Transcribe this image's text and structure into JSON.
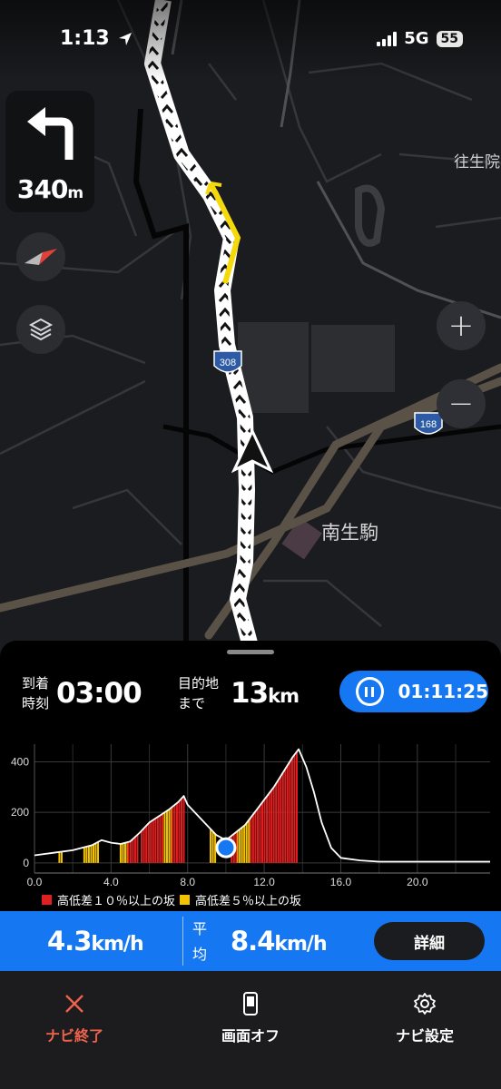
{
  "status_bar": {
    "time": "1:13",
    "network": "5G",
    "battery": "55"
  },
  "turn": {
    "distance": "340",
    "unit": "m"
  },
  "map": {
    "places": [
      {
        "id": "ojoin",
        "label": "往生院"
      },
      {
        "id": "minami",
        "label": "南生駒"
      }
    ],
    "route_shields": [
      {
        "id": "r308",
        "label": "308"
      },
      {
        "id": "r168",
        "label": "168"
      }
    ]
  },
  "controls": {
    "zoom_in": "+",
    "zoom_out": "−"
  },
  "trip": {
    "arrival_label_1": "到着",
    "arrival_label_2": "時刻",
    "arrival_time": "03:00",
    "dest_label_1": "目的地",
    "dest_label_2": "まで",
    "dest_distance": "13",
    "dest_unit": "km",
    "elapsed": "01:11:25"
  },
  "chart_data": {
    "type": "area",
    "title": "",
    "xlabel": "",
    "ylabel": "",
    "x_ticks": [
      "0.0",
      "4.0",
      "8.0",
      "12.0",
      "16.0",
      "20.0"
    ],
    "y_ticks": [
      "0",
      "200",
      "400"
    ],
    "xlim": [
      0,
      23.8
    ],
    "ylim": [
      -40,
      470
    ],
    "x": [
      0,
      1,
      2,
      3,
      3.5,
      4,
      4.5,
      5,
      5.5,
      6,
      6.5,
      7,
      7.5,
      7.8,
      8,
      8.5,
      9,
      9.5,
      10,
      10.5,
      11,
      11.5,
      12,
      12.5,
      13,
      13.5,
      13.8,
      14.2,
      14.6,
      15,
      15.5,
      16,
      17,
      18,
      19,
      20,
      21,
      22,
      23.8
    ],
    "y": [
      30,
      40,
      50,
      70,
      90,
      80,
      75,
      85,
      120,
      160,
      185,
      210,
      240,
      265,
      230,
      190,
      150,
      110,
      90,
      120,
      150,
      200,
      250,
      300,
      360,
      420,
      450,
      380,
      280,
      160,
      60,
      20,
      10,
      5,
      5,
      5,
      5,
      5,
      5
    ],
    "current_position_km": 10.0,
    "current_elevation": 60,
    "steep_10pct_ranges": [
      [
        4.9,
        5.4
      ],
      [
        5.6,
        6.8
      ],
      [
        7.2,
        7.9
      ],
      [
        10.3,
        10.6
      ],
      [
        11.3,
        13.8
      ]
    ],
    "steep_5pct_ranges": [
      [
        1.3,
        1.5
      ],
      [
        2.6,
        3.4
      ],
      [
        4.5,
        4.9
      ],
      [
        6.8,
        7.2
      ],
      [
        9.2,
        9.5
      ],
      [
        10.6,
        11.3
      ]
    ],
    "legend": [
      {
        "label": "高低差１０％以上の坂",
        "color": "#e02020"
      },
      {
        "label": "高低差５％以上の坂",
        "color": "#f5c400"
      }
    ],
    "line_color": "#ffffff",
    "grid": true
  },
  "speed": {
    "current": "4.3",
    "current_unit": "km/h",
    "avg_label_1": "平",
    "avg_label_2": "均",
    "average": "8.4",
    "average_unit": "km/h",
    "detail_button": "詳細"
  },
  "footer": {
    "end_nav": "ナビ終了",
    "screen_off": "画面オフ",
    "nav_settings": "ナビ設定"
  },
  "colors": {
    "accent": "#1677f2",
    "danger": "#f0624d",
    "route_highlight": "#f5d90a"
  }
}
